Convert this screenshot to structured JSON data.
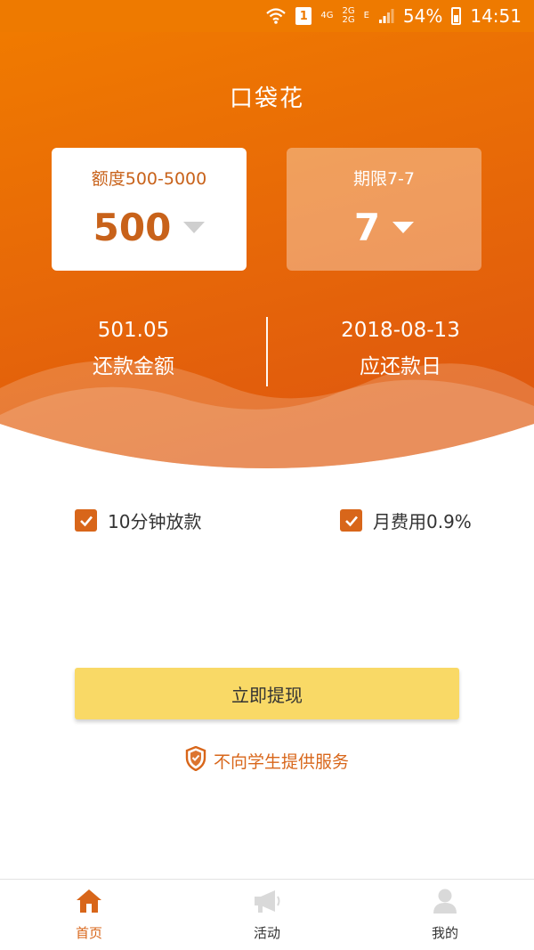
{
  "status_bar": {
    "sim_slot": "1",
    "network_4g": "4G",
    "network_2g_a": "2G",
    "network_2g_b": "2G",
    "network_e": "E",
    "battery_percent": "54%",
    "time": "14:51"
  },
  "header": {
    "title": "口袋花",
    "amount_card": {
      "label": "额度500-5000",
      "value": "500"
    },
    "term_card": {
      "label": "期限7-7",
      "value": "7"
    },
    "repay_amount": {
      "value": "501.05",
      "label": "还款金额"
    },
    "repay_date": {
      "value": "2018-08-13",
      "label": "应还款日"
    }
  },
  "features": [
    {
      "label": "10分钟放款",
      "checked": true
    },
    {
      "label": "月费用0.9%",
      "checked": true
    }
  ],
  "withdraw_button": {
    "label": "立即提现"
  },
  "notice": {
    "text": "不向学生提供服务"
  },
  "bottom_nav": [
    {
      "label": "首页",
      "icon": "home-icon",
      "active": true
    },
    {
      "label": "活动",
      "icon": "megaphone-icon",
      "active": false
    },
    {
      "label": "我的",
      "icon": "user-icon",
      "active": false
    }
  ],
  "colors": {
    "primary_orange": "#ee7a00",
    "accent_orange": "#d8661a",
    "button_yellow": "#f9d966"
  }
}
